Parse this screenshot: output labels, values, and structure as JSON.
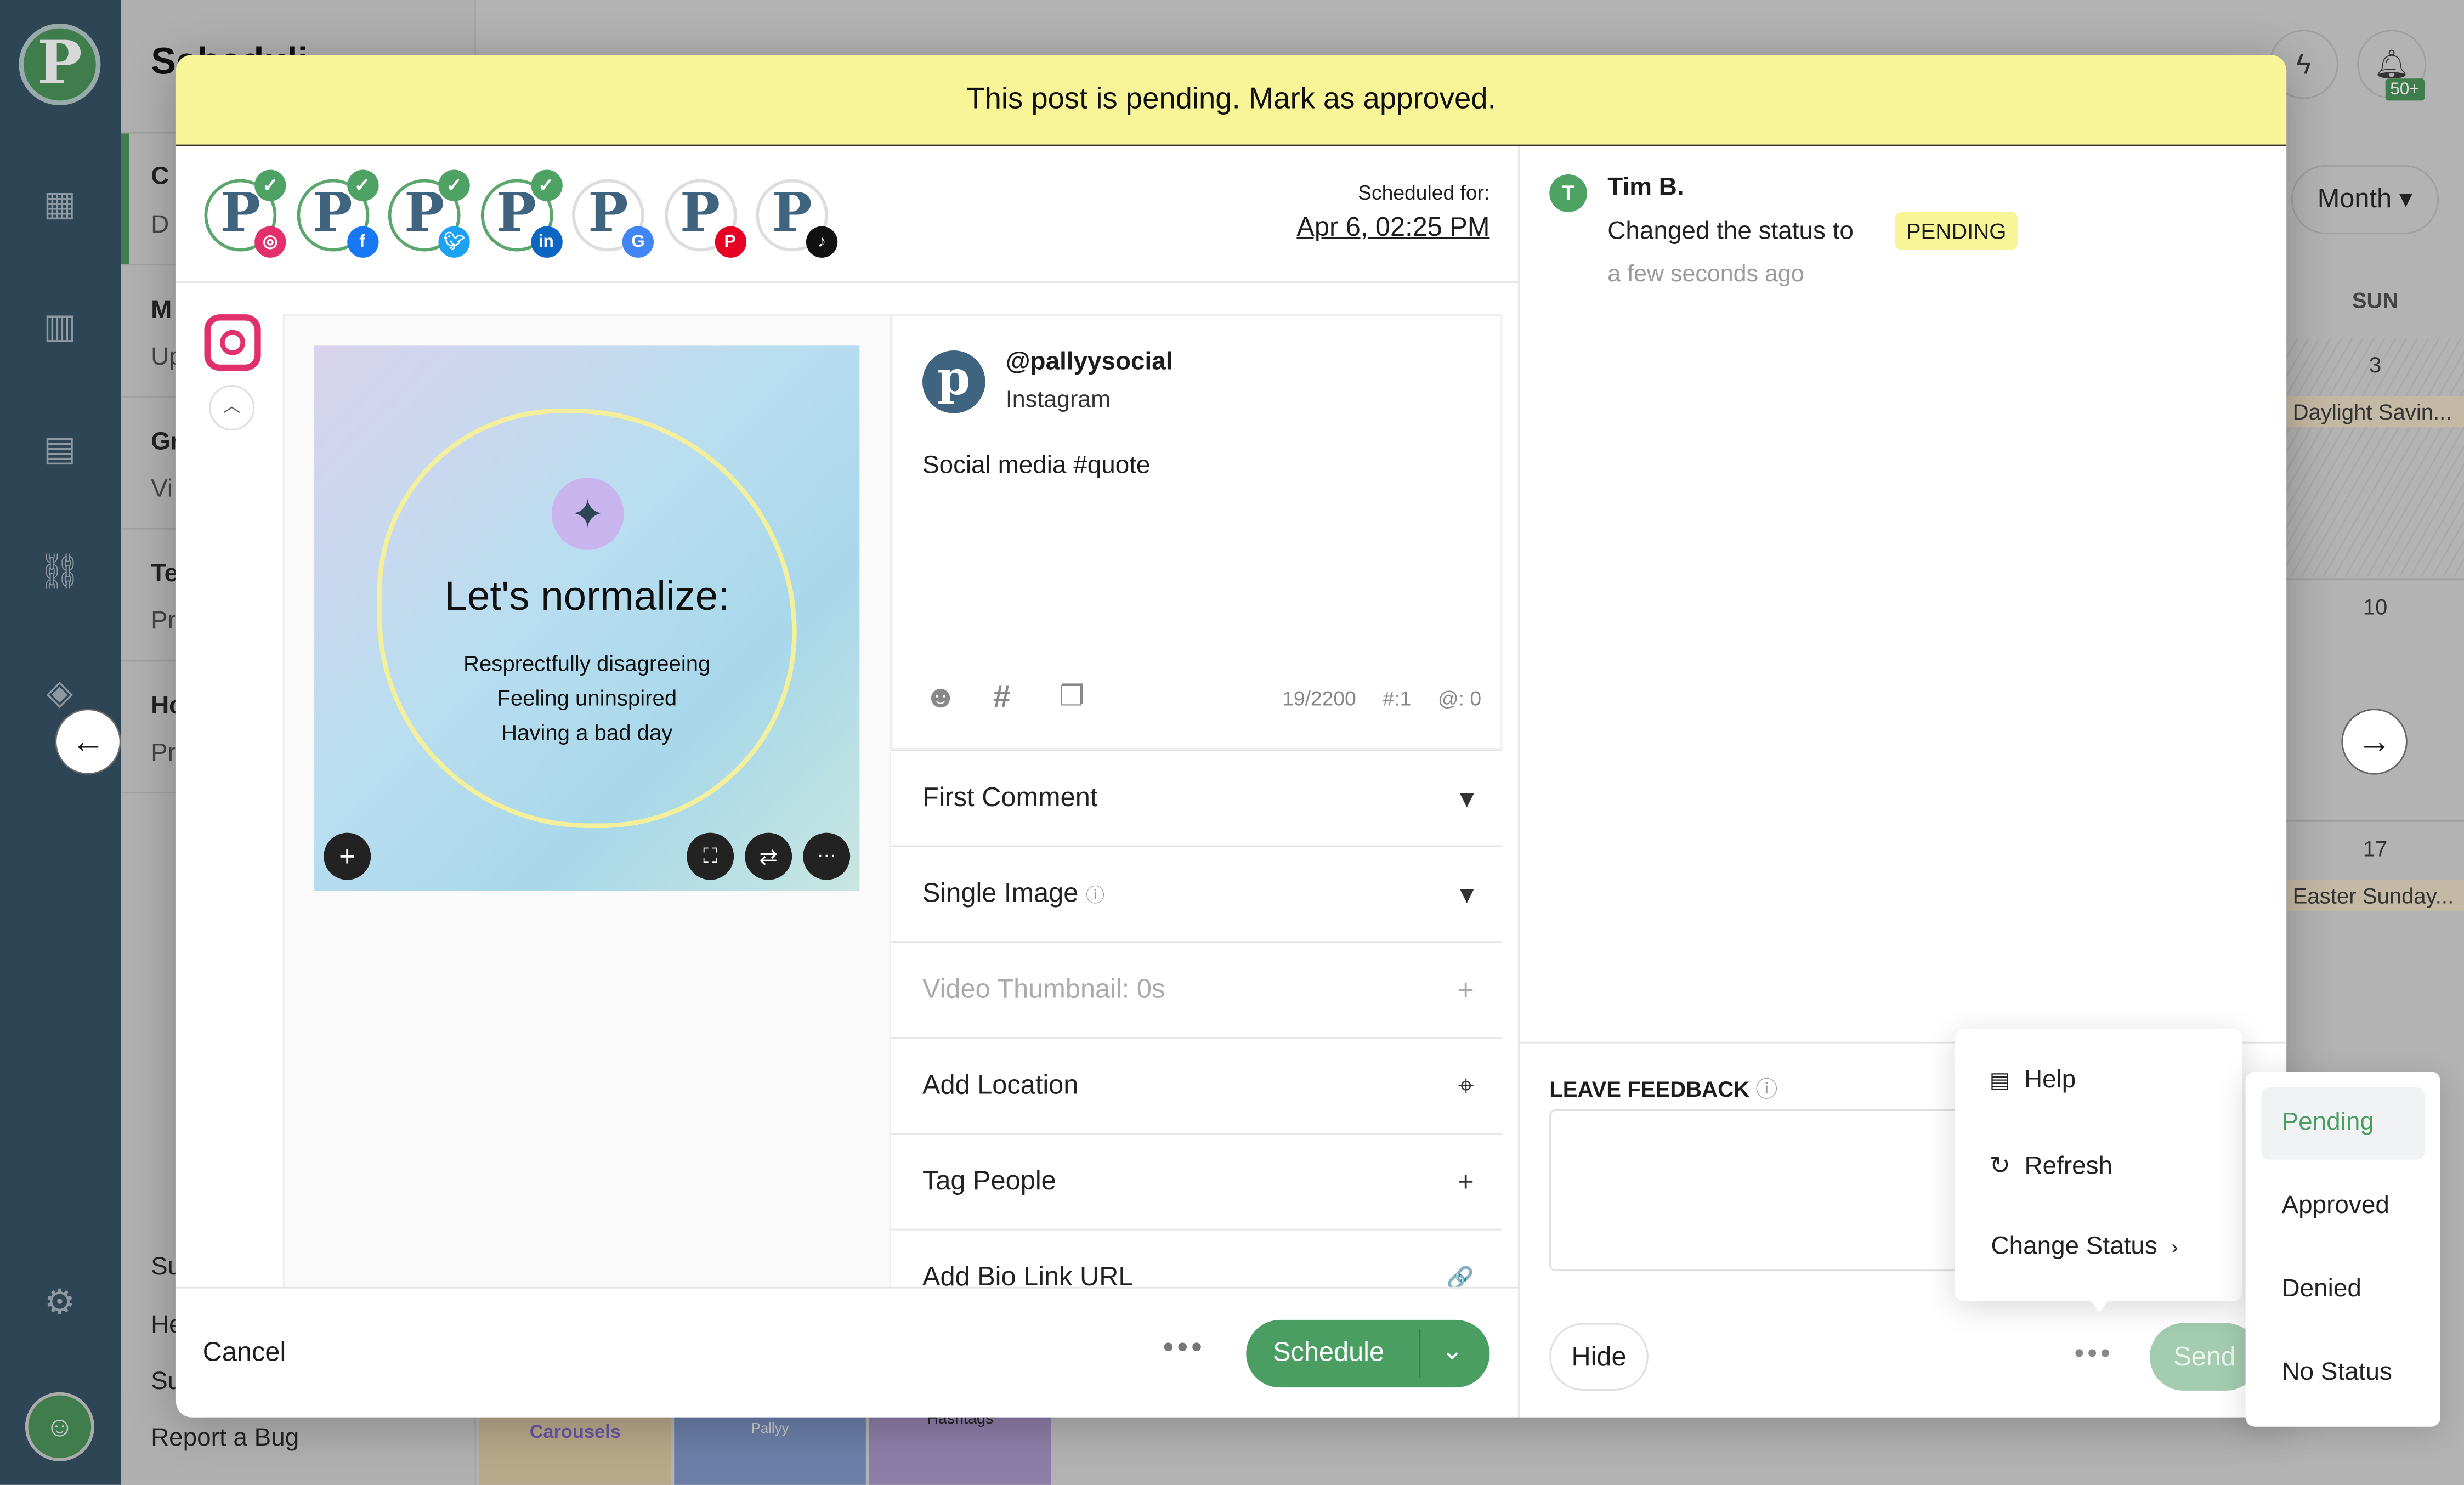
{
  "sidebar": {
    "logo": "P",
    "icons": [
      "calendar-icon",
      "chart-icon",
      "message-icon",
      "link-icon",
      "compass-icon",
      "gear-icon",
      "team-icon"
    ]
  },
  "left_panel": {
    "title": "Scheduli",
    "items": [
      {
        "title": "C",
        "sub": "D"
      },
      {
        "title": "M",
        "sub": "Up"
      },
      {
        "title": "Gr",
        "sub": "Vi"
      },
      {
        "title": "Te",
        "sub": "Pr"
      },
      {
        "title": "Ho",
        "sub": "Pr"
      }
    ],
    "bottom": [
      "Su",
      "He",
      "Su",
      "Report a Bug"
    ]
  },
  "calendar": {
    "view": "Month",
    "day_header": "SUN",
    "cells": [
      {
        "day": "3",
        "event": "Daylight Savin..."
      },
      {
        "day": "10",
        "event": ""
      },
      {
        "day": "17",
        "event": "Easter Sunday..."
      }
    ],
    "notifications": "50+",
    "thumbnails": [
      "Carousels",
      "Pallyy",
      "Hashtags"
    ]
  },
  "modal": {
    "banner": "This post is pending. Mark as approved.",
    "accounts": [
      {
        "network": "instagram",
        "selected": true
      },
      {
        "network": "facebook",
        "selected": true
      },
      {
        "network": "twitter",
        "selected": true
      },
      {
        "network": "linkedin",
        "selected": true
      },
      {
        "network": "google-business",
        "selected": false
      },
      {
        "network": "pinterest",
        "selected": false
      },
      {
        "network": "tiktok",
        "selected": false
      }
    ],
    "scheduled_label": "Scheduled for:",
    "scheduled_date": "Apr 6, 02:25 PM",
    "image": {
      "heading": "Let's normalize:",
      "lines": [
        "Resprectfully disagreeing",
        "Feeling uninspired",
        "Having a bad day"
      ]
    },
    "editor": {
      "handle": "@pallyysocial",
      "network": "Instagram",
      "text": "Social media #quote",
      "char_count": "19/2200",
      "hashtags": "#:1",
      "mentions": "@: 0"
    },
    "rows": [
      {
        "label": "First Comment",
        "icon": "▾"
      },
      {
        "label": "Single Image",
        "icon": "▾"
      },
      {
        "label": "Video Thumbnail: 0s",
        "icon": "+"
      },
      {
        "label": "Add Location",
        "icon": "⌖"
      },
      {
        "label": "Tag People",
        "icon": "+"
      },
      {
        "label": "Add Bio Link URL",
        "icon": "🔗"
      }
    ],
    "footer": {
      "cancel": "Cancel",
      "schedule": "Schedule"
    },
    "activity": {
      "avatar": "T",
      "user": "Tim B.",
      "action": "Changed the status to",
      "status": "PENDING",
      "time": "a few seconds ago"
    },
    "feedback": {
      "label": "LEAVE FEEDBACK",
      "hide": "Hide",
      "send": "Send"
    },
    "menu": {
      "items": [
        "Help",
        "Refresh",
        "Change Status"
      ]
    },
    "status_menu": {
      "options": [
        "Pending",
        "Approved",
        "Denied",
        "No Status"
      ],
      "selected": "Pending"
    }
  },
  "colors": {
    "accent": "#4a9e62",
    "banner": "#f7f597",
    "sidebar": "#2d4555"
  }
}
